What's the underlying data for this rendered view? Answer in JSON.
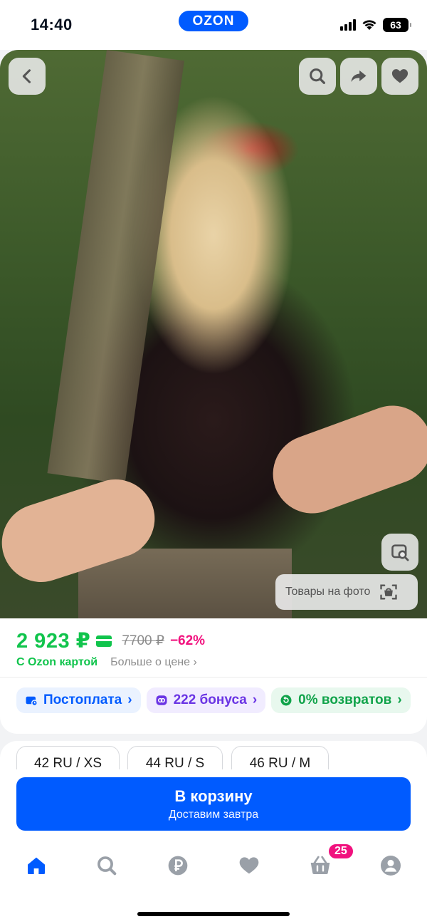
{
  "status_bar": {
    "time": "14:40",
    "battery": "63"
  },
  "header": {
    "logo": "OZON"
  },
  "photo": {
    "similar_label": "Товары на фото"
  },
  "price": {
    "current": "2 923 ₽",
    "old": "7700 ₽",
    "discount": "−62%",
    "with_card": "С Ozon картой",
    "more": "Больше о цене"
  },
  "chips": [
    {
      "label": "Постоплата"
    },
    {
      "label": "222 бонуса"
    },
    {
      "label": "0% возвратов"
    }
  ],
  "sizes": [
    "42 RU / XS",
    "44 RU / S",
    "46 RU / M"
  ],
  "cart_button": {
    "label": "В корзину",
    "subtitle": "Доставим завтра"
  },
  "tabbar": {
    "cart_badge": "25"
  },
  "colors": {
    "accent": "#005bff",
    "price_green": "#10c44c",
    "discount_pink": "#f1117e"
  }
}
